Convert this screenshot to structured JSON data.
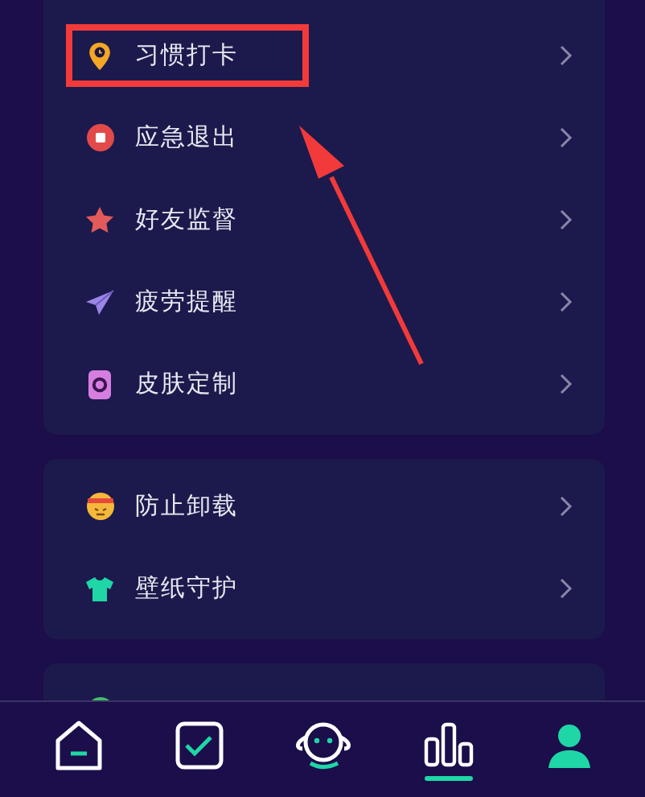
{
  "cards": [
    {
      "rows": [
        {
          "label": "习惯打卡",
          "highlighted": true
        },
        {
          "label": "应急退出",
          "highlighted": false
        },
        {
          "label": "好友监督",
          "highlighted": false
        },
        {
          "label": "疲劳提醒",
          "highlighted": false
        },
        {
          "label": "皮肤定制",
          "highlighted": false
        }
      ]
    },
    {
      "rows": [
        {
          "label": "防止卸载",
          "highlighted": false
        },
        {
          "label": "壁纸守护",
          "highlighted": false
        }
      ]
    },
    {
      "rows": [
        {
          "highlighted": false
        }
      ]
    }
  ],
  "tab_bar": [
    {
      "selected": false
    },
    {
      "selected": false
    },
    {
      "selected": false
    },
    {
      "selected": true
    },
    {
      "selected": false
    }
  ]
}
